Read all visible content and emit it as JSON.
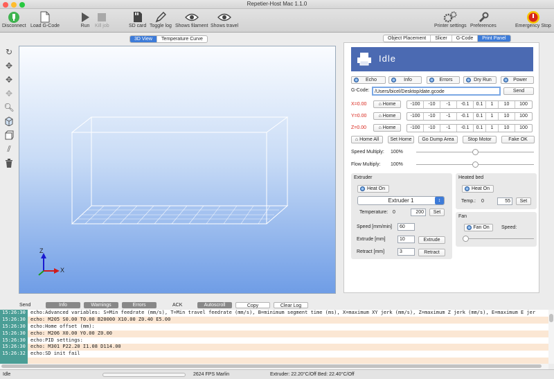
{
  "window": {
    "title": "Repetier-Host Mac 1.1.0"
  },
  "toolbar": {
    "disconnect": "Disconnect",
    "load_gcode": "Load G-Code",
    "run": "Run",
    "kill_job": "Kill job",
    "sd_card": "SD card",
    "toggle_log": "Toggle log",
    "shows_filament": "Shows filament",
    "shows_travel": "Shows travel",
    "printer_settings": "Printer settings",
    "preferences": "Preferences",
    "emergency_stop": "Emergency Stop"
  },
  "view_tabs": [
    {
      "label": "3D View",
      "selected": true
    },
    {
      "label": "Temperature Curve",
      "selected": false
    }
  ],
  "panel_tabs": [
    {
      "label": "Object Placement",
      "selected": false
    },
    {
      "label": "Slicer",
      "selected": false
    },
    {
      "label": "G-Code",
      "selected": false
    },
    {
      "label": "Print Panel",
      "selected": true
    }
  ],
  "viewport": {
    "axis_z": "Z",
    "axis_x": "X"
  },
  "print_panel": {
    "status": "Idle",
    "toggles": [
      "Echo",
      "Info",
      "Errors",
      "Dry Run",
      "Power"
    ],
    "gcode_label": "G-Code:",
    "gcode_value": "/Users/bicel/Desktop/date.gcode",
    "send": "Send",
    "axes": [
      {
        "label": "X=0.00",
        "home": "Home",
        "steps": [
          "-100",
          "-10",
          "-1",
          "-0.1",
          "0.1",
          "1",
          "10",
          "100"
        ]
      },
      {
        "label": "Y=0.00",
        "home": "Home",
        "steps": [
          "-100",
          "-10",
          "-1",
          "-0.1",
          "0.1",
          "1",
          "10",
          "100"
        ]
      },
      {
        "label": "Z=0.00",
        "home": "Home",
        "steps": [
          "-100",
          "-10",
          "-1",
          "-0.1",
          "0.1",
          "1",
          "10",
          "100"
        ]
      }
    ],
    "home_all": "Home All",
    "set_home": "Set Home",
    "go_dump_area": "Go Dump Area",
    "stop_motor": "Stop Motor",
    "fake_ok": "Fake OK",
    "speed_multiply_label": "Speed Multiply:",
    "speed_multiply_value": "100%",
    "speed_multiply_level": 0.5,
    "flow_multiply_label": "Flow Multiply:",
    "flow_multiply_value": "100%",
    "flow_multiply_level": 0.5,
    "extruder": {
      "title": "Extruder",
      "heat_on": "Heat On",
      "select": "Extruder 1",
      "temp_label": "Temperature:",
      "temp_current": "0",
      "temp_target": "200",
      "set": "Set",
      "speed_label": "Speed [mm/min]",
      "speed_value": "60",
      "extrude_label": "Extrude [mm]",
      "extrude_value": "10",
      "extrude_button": "Extrude",
      "retract_label": "Retract [mm]",
      "retract_value": "3",
      "retract_button": "Retract"
    },
    "heated_bed": {
      "title": "Heated bed",
      "heat_on": "Heat On",
      "temp_label": "Temp.:",
      "temp_current": "0",
      "temp_target": "55",
      "set": "Set"
    },
    "fan": {
      "title": "Fan",
      "fan_on": "Fan On",
      "speed_label": "Speed:",
      "speed_level": 0
    }
  },
  "log_bar": {
    "send": "Send",
    "info": "Info",
    "warnings": "Warnings",
    "errors": "Errors",
    "ack": "ACK",
    "autoscroll": "Autoscroll",
    "copy": "Copy",
    "clear_log": "Clear Log"
  },
  "log": [
    {
      "time": "15:26:30",
      "text": "echo:Advanced variables: S=Min feedrate (mm/s), T=Min travel feedrate (mm/s), B=minimum segment time (ms), X=maximum XY jerk (mm/s),  Z=maximum Z jerk (mm/s),  E=maximum E jer"
    },
    {
      "time": "15:26:30",
      "text": "echo:  M205 S0.00 T0.00 B20000 X10.00 Z0.40 E5.00"
    },
    {
      "time": "15:26:30",
      "text": "echo:Home offset (mm):"
    },
    {
      "time": "15:26:30",
      "text": "echo:  M206 X0.00 Y0.00 Z0.00"
    },
    {
      "time": "15:26:30",
      "text": "echo:PID settings:"
    },
    {
      "time": "15:26:30",
      "text": "echo:   M301 P22.20 I1.08 D114.00"
    },
    {
      "time": "15:26:32",
      "text": "echo:SD init fail"
    }
  ],
  "status_bar": {
    "state": "Idle",
    "fps": "2624 FPS Marlin",
    "temps": "Extruder: 22.20°C/Off Bed: 22.40°C/Off"
  },
  "colors": {
    "accent": "#3d7bd8",
    "idle_bar": "#4b6ab2",
    "axis_label": "#d9261c",
    "log_time": "#4b9e96"
  }
}
